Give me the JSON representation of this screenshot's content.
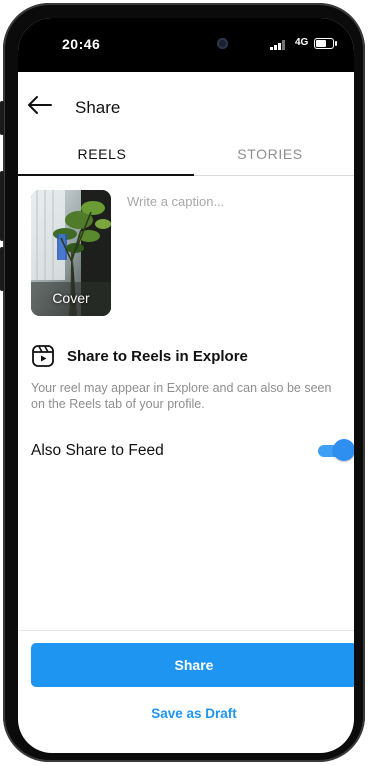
{
  "status_bar": {
    "time": "20:46",
    "network": "4G"
  },
  "header": {
    "title": "Share"
  },
  "tabs": [
    {
      "label": "REELS"
    },
    {
      "label": "STORIES"
    }
  ],
  "cover": {
    "label": "Cover"
  },
  "caption": {
    "placeholder": "Write a caption..."
  },
  "explore": {
    "title": "Share to Reels in Explore",
    "description": "Your reel may appear in Explore and can also be seen on the Reels tab of your profile."
  },
  "feed": {
    "label": "Also Share to Feed",
    "enabled": true
  },
  "actions": {
    "share_label": "Share",
    "draft_label": "Save as Draft"
  },
  "colors": {
    "accent": "#1f95f2",
    "toggle": "#2f8ff0",
    "text_secondary": "#8e8e8e"
  },
  "icons": {
    "back": "arrow-left-icon",
    "reels": "reels-icon",
    "camera": "front-camera-icon",
    "signal": "signal-icon",
    "battery": "battery-icon"
  }
}
